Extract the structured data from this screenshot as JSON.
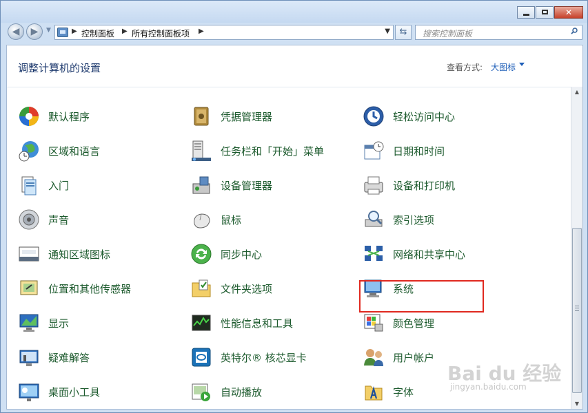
{
  "window": {
    "caption": {
      "minimize": "–",
      "maximize": "□",
      "close": "✕"
    }
  },
  "navbar": {
    "breadcrumbs": [
      "控制面板",
      "所有控制面板项"
    ],
    "search_placeholder": "搜索控制面板"
  },
  "header": {
    "title": "调整计算机的设置",
    "view_label": "查看方式:",
    "view_value": "大图标"
  },
  "items": [
    {
      "label": "默认程序",
      "icon": "default-programs-icon"
    },
    {
      "label": "凭据管理器",
      "icon": "credential-manager-icon"
    },
    {
      "label": "轻松访问中心",
      "icon": "ease-of-access-icon"
    },
    {
      "label": "区域和语言",
      "icon": "region-language-icon"
    },
    {
      "label": "任务栏和「开始」菜单",
      "icon": "taskbar-icon"
    },
    {
      "label": "日期和时间",
      "icon": "date-time-icon"
    },
    {
      "label": "入门",
      "icon": "getting-started-icon"
    },
    {
      "label": "设备管理器",
      "icon": "device-manager-icon"
    },
    {
      "label": "设备和打印机",
      "icon": "devices-printers-icon"
    },
    {
      "label": "声音",
      "icon": "sound-icon"
    },
    {
      "label": "鼠标",
      "icon": "mouse-icon"
    },
    {
      "label": "索引选项",
      "icon": "indexing-icon"
    },
    {
      "label": "通知区域图标",
      "icon": "notification-icon"
    },
    {
      "label": "同步中心",
      "icon": "sync-center-icon"
    },
    {
      "label": "网络和共享中心",
      "icon": "network-sharing-icon"
    },
    {
      "label": "位置和其他传感器",
      "icon": "sensors-icon"
    },
    {
      "label": "文件夹选项",
      "icon": "folder-options-icon"
    },
    {
      "label": "系统",
      "icon": "system-icon"
    },
    {
      "label": "显示",
      "icon": "display-icon"
    },
    {
      "label": "性能信息和工具",
      "icon": "performance-icon"
    },
    {
      "label": "颜色管理",
      "icon": "color-management-icon"
    },
    {
      "label": "疑难解答",
      "icon": "troubleshooting-icon"
    },
    {
      "label": "英特尔® 核芯显卡",
      "icon": "intel-graphics-icon"
    },
    {
      "label": "用户帐户",
      "icon": "user-accounts-icon"
    },
    {
      "label": "桌面小工具",
      "icon": "gadgets-icon"
    },
    {
      "label": "自动播放",
      "icon": "autoplay-icon"
    },
    {
      "label": "字体",
      "icon": "fonts-icon"
    }
  ],
  "watermark": {
    "logo": "Bai du 经验",
    "url": "jingyan.baidu.com"
  }
}
